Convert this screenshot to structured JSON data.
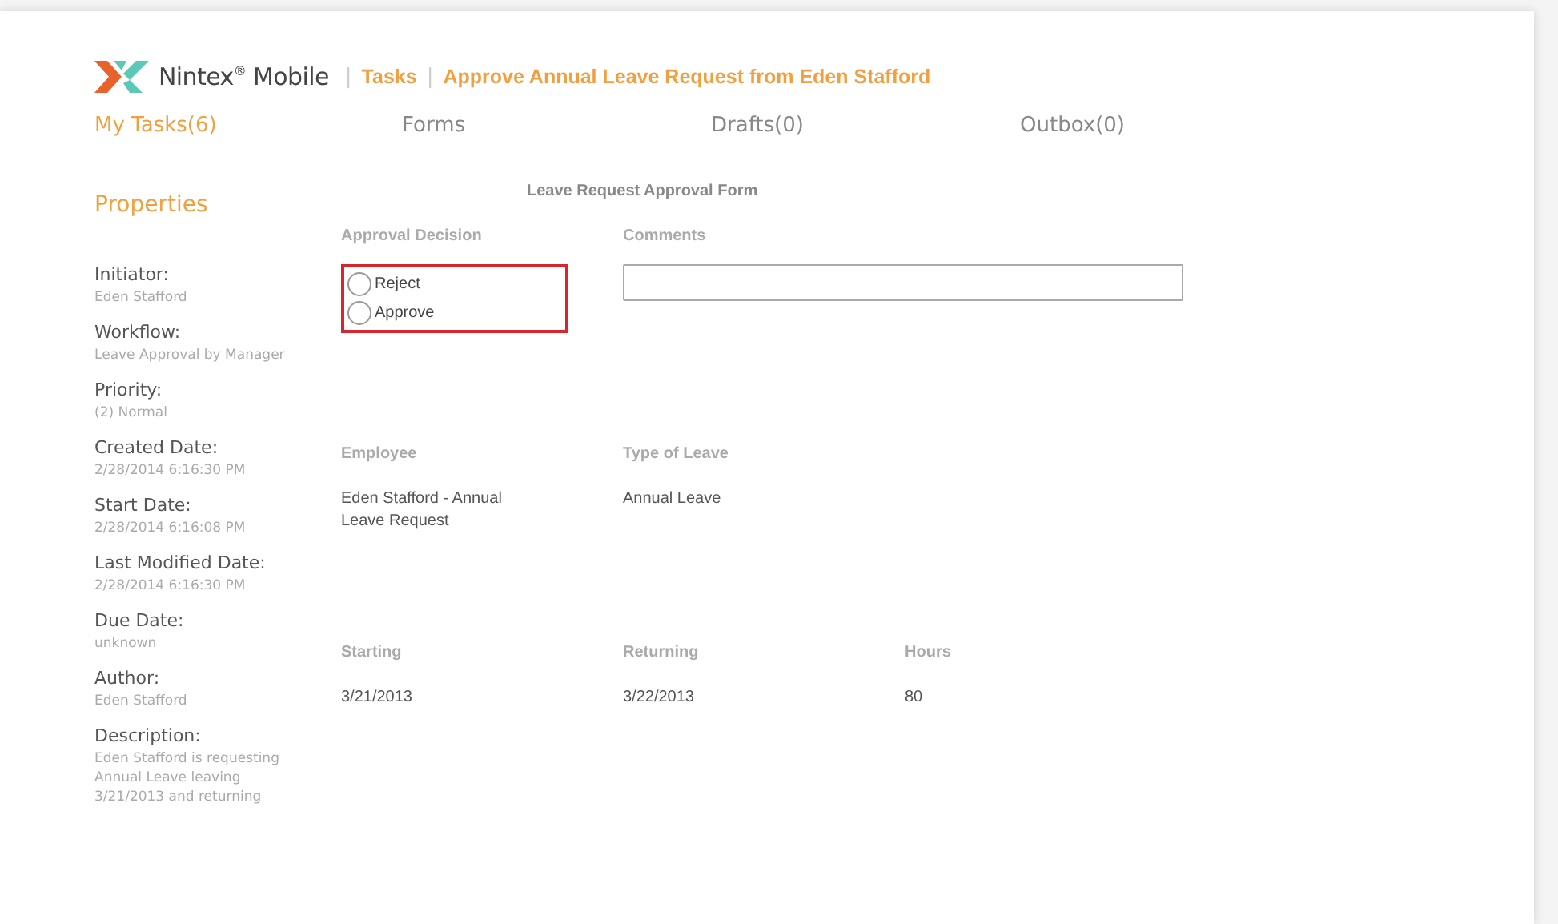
{
  "header": {
    "logo_text": "Nintex$^{®}$ Mobile",
    "breadcrumb": [
      {
        "separator": "|",
        "label": "Tasks"
      },
      {
        "separator": "|",
        "label": "Approve Annual Leave Request from Eden Stafford"
      }
    ]
  },
  "tabs": [
    {
      "label": "My Tasks(6)",
      "selected": true
    },
    {
      "label": "Forms",
      "selected": false
    },
    {
      "label": "Drafts(0)",
      "selected": false
    },
    {
      "label": "Outbox(0)",
      "selected": false
    }
  ],
  "properties": {
    "title": "Properties",
    "items": [
      {
        "label": "Initiator:",
        "value": "Eden Stafford"
      },
      {
        "label": "Workflow:",
        "value": "Leave Approval by Manager"
      },
      {
        "label": "Priority:",
        "value": "(2) Normal"
      },
      {
        "label": "Created Date:",
        "value": "2/28/2014 6:16:30 PM"
      },
      {
        "label": "Start Date:",
        "value": "2/28/2014 6:16:08 PM"
      },
      {
        "label": "Last Modified Date:",
        "value": "2/28/2014 6:16:30 PM"
      },
      {
        "label": "Due Date:",
        "value": "unknown"
      },
      {
        "label": "Author:",
        "value": "Eden Stafford"
      },
      {
        "label": "Description:",
        "value": "Eden Stafford is requesting Annual Leave leaving 3/21/2013 and returning"
      }
    ]
  },
  "form": {
    "title": "Leave Request Approval Form",
    "approval_decision": {
      "label": "Approval Decision",
      "highlighted": true,
      "options": [
        {
          "label": "Reject",
          "selected": false
        },
        {
          "label": "Approve",
          "selected": false
        }
      ]
    },
    "comments": {
      "label": "Comments"
    },
    "employee": {
      "label": "Employee",
      "value": "Eden Stafford - Annual Leave Request"
    },
    "type_of_leave": {
      "label": "Type of Leave",
      "value": "Annual Leave"
    },
    "starting": {
      "label": "Starting",
      "value": "3/21/2013"
    },
    "returning": {
      "label": "Returning",
      "value": "3/22/2013"
    },
    "hours": {
      "label": "Hours",
      "value": "80"
    }
  }
}
